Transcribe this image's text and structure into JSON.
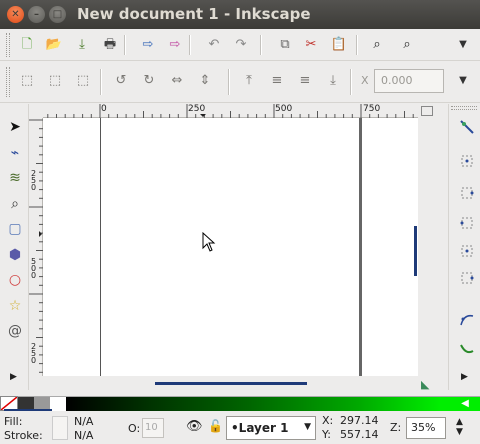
{
  "window": {
    "title": "New document 1 - Inkscape"
  },
  "titlebar": {
    "close_glyph": "✕",
    "min_glyph": "–",
    "max_glyph": "□"
  },
  "toolbar_commands": [
    {
      "name": "new-document-icon",
      "glyph": "🗋",
      "color": "#4a9a2a"
    },
    {
      "name": "open-icon",
      "glyph": "📂",
      "color": "#c88a2a"
    },
    {
      "name": "save-icon",
      "glyph": "⤓",
      "color": "#4a7a2a"
    },
    {
      "name": "print-icon",
      "glyph": "🖶",
      "color": "#444"
    },
    {
      "name": "import-icon",
      "glyph": "⇨",
      "color": "#3a6ab8"
    },
    {
      "name": "export-icon",
      "glyph": "⇨",
      "color": "#c04aa0"
    },
    {
      "name": "undo-icon",
      "glyph": "↶",
      "color": "#888"
    },
    {
      "name": "redo-icon",
      "glyph": "↷",
      "color": "#888"
    },
    {
      "name": "duplicate-icon",
      "glyph": "⧉",
      "color": "#666"
    },
    {
      "name": "cut-icon",
      "glyph": "✂",
      "color": "#c0302a"
    },
    {
      "name": "paste-icon",
      "glyph": "📋",
      "color": "#8a6a3a"
    },
    {
      "name": "zoom-selection-icon",
      "glyph": "⌕",
      "color": "#222"
    },
    {
      "name": "zoom-drawing-icon",
      "glyph": "⌕",
      "color": "#222"
    }
  ],
  "toolbar_controls": [
    {
      "name": "select-all-icon",
      "glyph": "⬚"
    },
    {
      "name": "select-all-layers-icon",
      "glyph": "⬚"
    },
    {
      "name": "deselect-icon",
      "glyph": "⬚"
    },
    {
      "name": "rotate-ccw-icon",
      "glyph": "↺"
    },
    {
      "name": "rotate-cw-icon",
      "glyph": "↻"
    },
    {
      "name": "flip-horizontal-icon",
      "glyph": "⇔"
    },
    {
      "name": "flip-vertical-icon",
      "glyph": "⇕"
    },
    {
      "name": "raise-to-top-icon",
      "glyph": "⤒"
    },
    {
      "name": "raise-icon",
      "glyph": "≡"
    },
    {
      "name": "lower-icon",
      "glyph": "≡"
    },
    {
      "name": "lower-to-bottom-icon",
      "glyph": "⤓"
    }
  ],
  "coords": {
    "x_label": "X",
    "x_value": "0.000"
  },
  "ruler": {
    "h_labels": [
      "0",
      "250",
      "500",
      "750"
    ],
    "v_labels": [
      "250",
      "500",
      "250"
    ]
  },
  "tools": [
    {
      "name": "selector-tool-icon",
      "glyph": "➤"
    },
    {
      "name": "node-tool-icon",
      "glyph": "⌁"
    },
    {
      "name": "tweak-tool-icon",
      "glyph": "≋"
    },
    {
      "name": "zoom-tool-icon",
      "glyph": "⌕"
    },
    {
      "name": "rectangle-tool-icon",
      "glyph": "▢"
    },
    {
      "name": "3d-box-tool-icon",
      "glyph": "⬢"
    },
    {
      "name": "ellipse-tool-icon",
      "glyph": "○"
    },
    {
      "name": "star-tool-icon",
      "glyph": "☆"
    },
    {
      "name": "spiral-tool-icon",
      "glyph": "@"
    }
  ],
  "snap_tools": [
    {
      "name": "snap-toggle-icon"
    },
    {
      "name": "snap-bbox-icon"
    },
    {
      "name": "snap-bbox-edge-icon"
    },
    {
      "name": "snap-bbox-corner-icon"
    },
    {
      "name": "snap-bbox-midpoint-icon"
    },
    {
      "name": "snap-bbox-center-icon"
    },
    {
      "name": "snap-nodes-icon"
    },
    {
      "name": "snap-path-icon"
    }
  ],
  "status": {
    "fill_label": "Fill:",
    "fill_value": "N/A",
    "stroke_label": "Stroke:",
    "stroke_value": "N/A",
    "opacity_label": "O:",
    "opacity_value": "10",
    "layer": "•Layer 1",
    "x_label": "X:",
    "x_value": "297.14",
    "y_label": "Y:",
    "y_value": "557.14",
    "z_label": "Z:",
    "zoom": "35%"
  }
}
